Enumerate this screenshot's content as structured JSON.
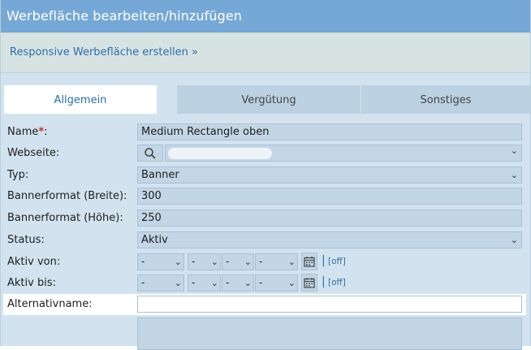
{
  "dialog": {
    "title": "Werbefläche bearbeiten/hinzufügen",
    "responsive_link": "Responsive Werbefläche erstellen »"
  },
  "tabs": [
    {
      "label": "Allgemein",
      "active": true
    },
    {
      "label": "Vergütung",
      "active": false
    },
    {
      "label": "Sonstiges",
      "active": false
    }
  ],
  "form": {
    "name": {
      "label": "Name",
      "required_mark": "*",
      "colon": ":",
      "value": "Medium Rectangle oben"
    },
    "webseite": {
      "label": "Webseite:",
      "value": ""
    },
    "typ": {
      "label": "Typ:",
      "value": "Banner"
    },
    "breite": {
      "label": "Bannerformat (Breite):",
      "value": "300"
    },
    "hoehe": {
      "label": "Bannerformat (Höhe):",
      "value": "250"
    },
    "status": {
      "label": "Status:",
      "value": "Aktiv"
    },
    "aktiv_von": {
      "label": "Aktiv von:",
      "date": "-",
      "hour": "-",
      "minute": "-",
      "second": "-",
      "off": "[off]"
    },
    "aktiv_bis": {
      "label": "Aktiv bis:",
      "date": "-",
      "hour": "-",
      "minute": "-",
      "second": "-",
      "off": "[off]"
    },
    "alternativname": {
      "label": "Alternativname:",
      "value": ""
    }
  },
  "icons": {
    "chevron": "chevron-down-icon",
    "search": "search-icon",
    "calendar": "calendar-icon"
  },
  "colors": {
    "titlebar": "#76a8d7",
    "panel": "#d2e3ef",
    "link": "#2f6ea9",
    "required": "#c0392b"
  }
}
